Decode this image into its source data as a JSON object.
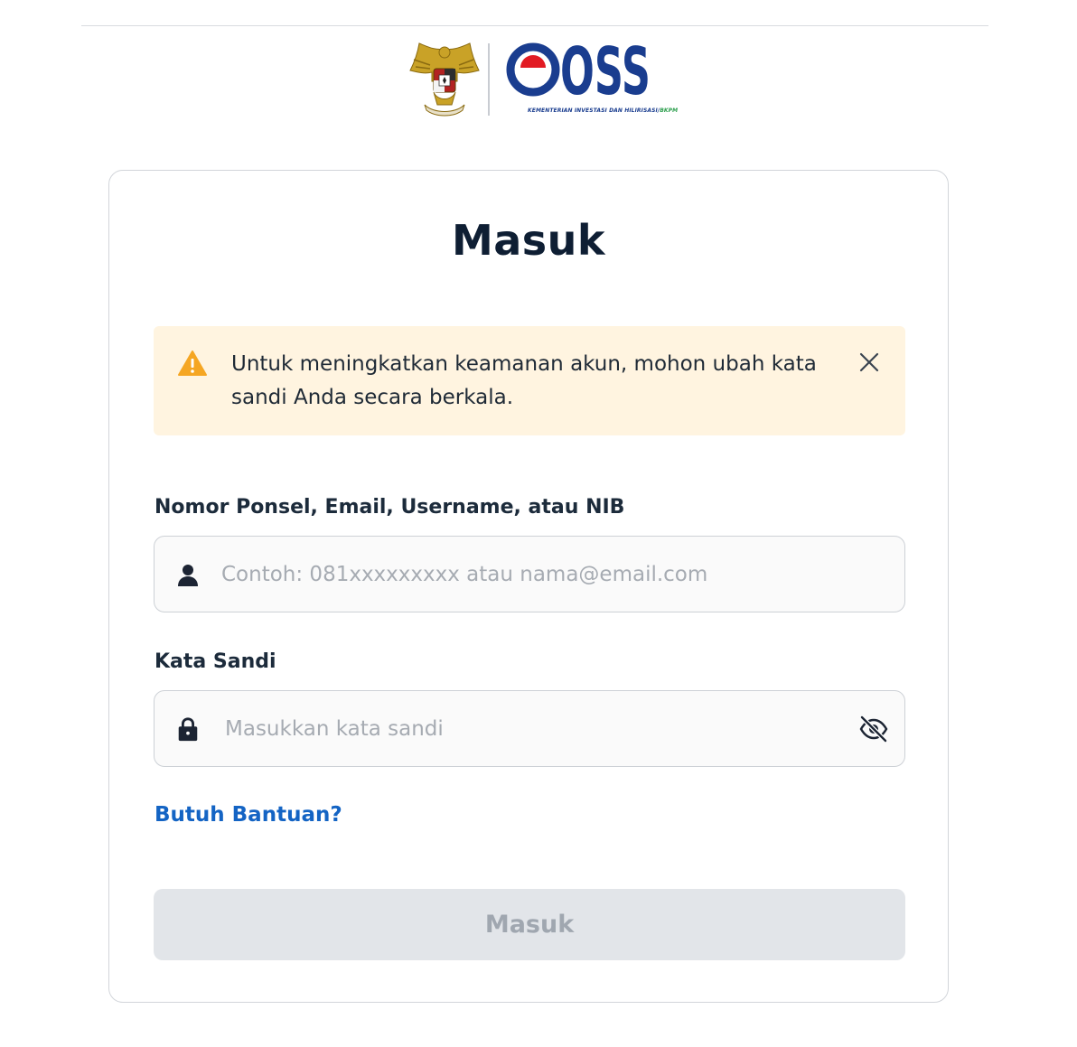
{
  "header": {
    "logo_wordmark": "OSS",
    "logo_subtitle_main": "KEMENTERIAN INVESTASI DAN HILIRISASI/",
    "logo_subtitle_accent": "BKPM"
  },
  "login": {
    "title": "Masuk",
    "alert": {
      "message": "Untuk meningkatkan keamanan akun, mohon ubah kata sandi Anda secara berkala."
    },
    "identifier_field": {
      "label": "Nomor Ponsel, Email, Username, atau NIB",
      "value": "",
      "placeholder": "Contoh: 081xxxxxxxxx atau nama@email.com"
    },
    "password_field": {
      "label": "Kata Sandi",
      "value": "",
      "placeholder": "Masukkan kata sandi"
    },
    "help_link": "Butuh Bantuan?",
    "submit_label": "Masuk"
  },
  "colors": {
    "brand_blue": "#1a3d8f",
    "link_blue": "#1464c4",
    "alert_bg": "#fff4e0",
    "warning_amber": "#f5a623",
    "disabled_button": "#e2e5e9"
  },
  "icons": {
    "emblem": "garuda-emblem-icon",
    "alert": "warning-triangle-icon",
    "close": "close-icon",
    "user": "user-icon",
    "lock": "lock-icon",
    "visibility": "eye-off-icon"
  }
}
